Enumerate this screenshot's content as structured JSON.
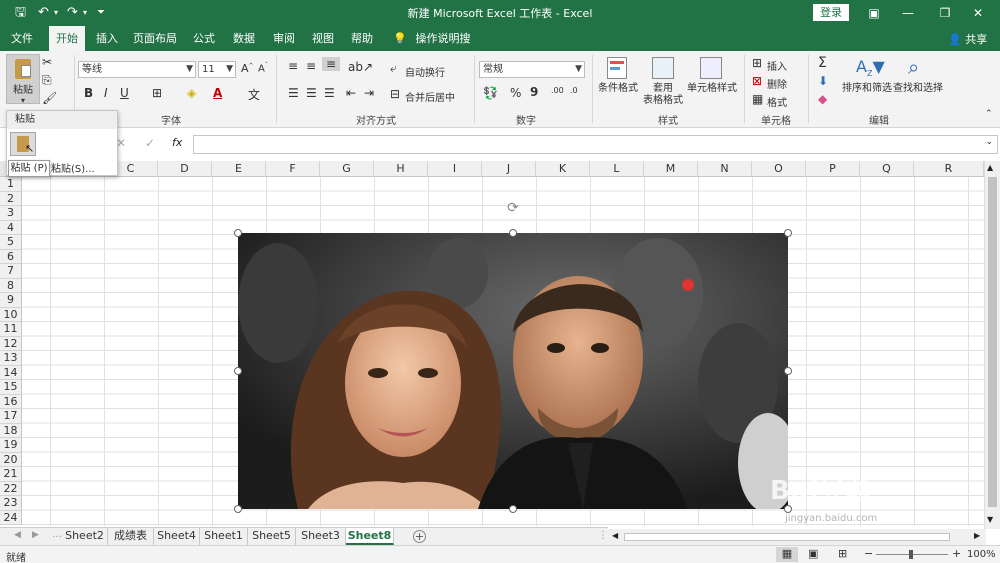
{
  "window": {
    "title": "新建 Microsoft Excel 工作表 - Excel",
    "login_label": "登录"
  },
  "tabs": [
    {
      "label": "文件"
    },
    {
      "label": "开始"
    },
    {
      "label": "插入"
    },
    {
      "label": "页面布局"
    },
    {
      "label": "公式"
    },
    {
      "label": "数据"
    },
    {
      "label": "审阅"
    },
    {
      "label": "视图"
    },
    {
      "label": "帮助"
    },
    {
      "label": "操作说明搜索"
    }
  ],
  "share_label": "共享",
  "ribbon": {
    "paste_label": "粘贴",
    "font_name": "等线",
    "font_size": "11",
    "font_group_label": "字体",
    "wrap_text_label": "自动换行",
    "merge_center_label": "合并后居中",
    "align_group_label": "对齐方式",
    "number_format": "常规",
    "number_group_label": "数字",
    "cond_format_label": "条件格式",
    "table_format_label1": "套用",
    "table_format_label2": "表格格式",
    "cell_style_label": "单元格样式",
    "style_group_label": "样式",
    "insert_label": "插入",
    "delete_label": "删除",
    "format_label": "格式",
    "cells_group_label": "单元格",
    "sort_filter_label": "排序和筛选",
    "find_select_label": "查找和选择",
    "edit_group_label": "编辑",
    "bold": "B",
    "italic": "I",
    "underline": "U",
    "percent": "%",
    "comma": "9"
  },
  "paste_menu": {
    "header": "粘贴",
    "special_label": "性粘贴(S)...",
    "tooltip": "粘贴 (P)"
  },
  "formula_bar": {
    "fx": "fx",
    "cancel": "✕",
    "enter": "✓"
  },
  "columns": [
    "C",
    "D",
    "E",
    "F",
    "G",
    "H",
    "I",
    "J",
    "K",
    "L",
    "M",
    "N",
    "O",
    "P",
    "Q",
    "R"
  ],
  "rows": [
    "1",
    "2",
    "3",
    "4",
    "5",
    "6",
    "7",
    "8",
    "9",
    "10",
    "11",
    "12",
    "13",
    "14",
    "15",
    "16",
    "17",
    "18",
    "19",
    "20",
    "21",
    "22",
    "23",
    "24"
  ],
  "sheets": [
    {
      "label": "Sheet2"
    },
    {
      "label": "成绩表"
    },
    {
      "label": "Sheet4"
    },
    {
      "label": "Sheet1"
    },
    {
      "label": "Sheet5"
    },
    {
      "label": "Sheet3"
    },
    {
      "label": "Sheet8"
    }
  ],
  "active_sheet": "Sheet8",
  "status": {
    "ready": "就绪",
    "zoom": "100%"
  },
  "watermark": {
    "brand": "Bai经验",
    "url": "jingyan.baidu.com"
  },
  "colors": {
    "excel_green": "#217346",
    "ribbon_bg": "#f3f3f3"
  }
}
